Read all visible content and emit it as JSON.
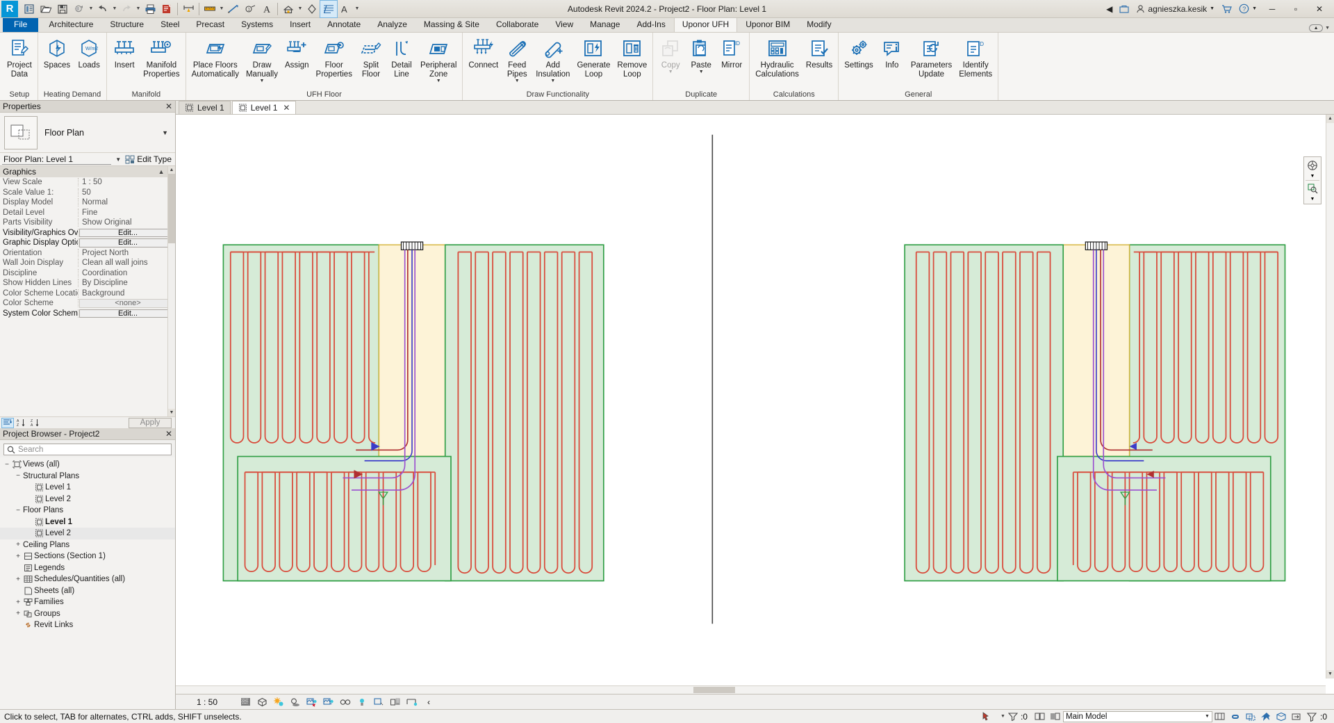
{
  "app": {
    "title": "Autodesk Revit 2024.2 - Project2 - Floor Plan: Level 1",
    "logo_letter": "R",
    "user": "agnieszka.kesik"
  },
  "quick_access": {
    "items": [
      {
        "name": "open-project-icon",
        "label": "Open"
      },
      {
        "name": "save-icon",
        "label": "Save"
      },
      {
        "name": "save-as-icon",
        "label": "Save As"
      },
      {
        "name": "undo-icon",
        "label": "Undo"
      },
      {
        "name": "redo-icon",
        "label": "Redo"
      },
      {
        "name": "print-icon",
        "label": "Print"
      },
      {
        "name": "measure-icon",
        "label": "Measure"
      },
      {
        "name": "aligned-dimension-icon",
        "label": "Aligned Dimension"
      },
      {
        "name": "tag-icon",
        "label": "Tag by Category"
      },
      {
        "name": "text-icon",
        "label": "Text"
      },
      {
        "name": "default-3d-view-icon",
        "label": "Default 3D View"
      },
      {
        "name": "section-icon",
        "label": "Section"
      },
      {
        "name": "thin-lines-icon",
        "label": "Thin Lines"
      },
      {
        "name": "close-hidden-windows-icon",
        "label": "Close Hidden Windows"
      }
    ]
  },
  "title_bar_right": {
    "search_placeholder": "",
    "account": "agnieszka.kesik",
    "icons": [
      "app-store-icon",
      "help-icon"
    ],
    "window_buttons": [
      "minimize",
      "maximize",
      "close"
    ]
  },
  "ribbon": {
    "tabs": [
      {
        "label": "File",
        "kind": "file"
      },
      {
        "label": "Architecture"
      },
      {
        "label": "Structure"
      },
      {
        "label": "Steel"
      },
      {
        "label": "Precast"
      },
      {
        "label": "Systems"
      },
      {
        "label": "Insert"
      },
      {
        "label": "Annotate"
      },
      {
        "label": "Analyze"
      },
      {
        "label": "Massing & Site"
      },
      {
        "label": "Collaborate"
      },
      {
        "label": "View"
      },
      {
        "label": "Manage"
      },
      {
        "label": "Add-Ins"
      },
      {
        "label": "Uponor UFH",
        "active": true
      },
      {
        "label": "Uponor BIM"
      },
      {
        "label": "Modify"
      }
    ],
    "panels": [
      {
        "title": "Setup",
        "buttons": [
          {
            "label": "Project\nData",
            "icon": "project-data-icon",
            "name": "project-data-button"
          }
        ]
      },
      {
        "title": "Heating Demand",
        "buttons": [
          {
            "label": "Spaces",
            "icon": "spaces-icon",
            "name": "spaces-button"
          },
          {
            "label": "Loads",
            "icon": "loads-icon",
            "name": "loads-button"
          }
        ]
      },
      {
        "title": "Manifold",
        "buttons": [
          {
            "label": "Insert",
            "icon": "manifold-insert-icon",
            "name": "insert-manifold-button"
          },
          {
            "label": "Manifold\nProperties",
            "icon": "manifold-properties-icon",
            "name": "manifold-properties-button"
          }
        ]
      },
      {
        "title": "UFH Floor",
        "buttons": [
          {
            "label": "Place Floors\nAutomatically",
            "icon": "place-floors-icon",
            "name": "place-floors-automatically-button"
          },
          {
            "label": "Draw\nManually",
            "icon": "draw-manually-icon",
            "name": "draw-manually-button",
            "dropdown": true
          },
          {
            "label": "Assign",
            "icon": "assign-icon",
            "name": "assign-button"
          },
          {
            "label": "Floor\nProperties",
            "icon": "floor-properties-icon",
            "name": "floor-properties-button"
          },
          {
            "label": "Split\nFloor",
            "icon": "split-floor-icon",
            "name": "split-floor-button"
          },
          {
            "label": "Detail\nLine",
            "icon": "detail-line-icon",
            "name": "detail-line-button"
          },
          {
            "label": "Peripheral\nZone",
            "icon": "peripheral-zone-icon",
            "name": "peripheral-zone-button",
            "dropdown": true
          }
        ]
      },
      {
        "title": "Draw Functionality",
        "buttons": [
          {
            "label": "Connect",
            "icon": "connect-icon",
            "name": "connect-button"
          },
          {
            "label": "Feed\nPipes",
            "icon": "feed-pipes-icon",
            "name": "feed-pipes-button",
            "dropdown": true
          },
          {
            "label": "Add\nInsulation",
            "icon": "add-insulation-icon",
            "name": "add-insulation-button",
            "dropdown": true
          },
          {
            "label": "Generate\nLoop",
            "icon": "generate-loop-icon",
            "name": "generate-loop-button"
          },
          {
            "label": "Remove\nLoop",
            "icon": "remove-loop-icon",
            "name": "remove-loop-button"
          }
        ]
      },
      {
        "title": "Duplicate",
        "buttons": [
          {
            "label": "Copy",
            "icon": "copy-icon",
            "name": "copy-button",
            "dropdown": true,
            "disabled": true
          },
          {
            "label": "Paste",
            "icon": "paste-icon",
            "name": "paste-button",
            "dropdown": true
          },
          {
            "label": "Mirror",
            "icon": "mirror-icon",
            "name": "mirror-button"
          }
        ]
      },
      {
        "title": "Calculations",
        "buttons": [
          {
            "label": "Hydraulic\nCalculations",
            "icon": "hydraulic-calculations-icon",
            "name": "hydraulic-calculations-button"
          },
          {
            "label": "Results",
            "icon": "results-icon",
            "name": "results-button"
          }
        ]
      },
      {
        "title": "General",
        "buttons": [
          {
            "label": "Settings",
            "icon": "settings-icon",
            "name": "settings-button"
          },
          {
            "label": "Info",
            "icon": "info-icon",
            "name": "info-button"
          },
          {
            "label": "Parameters\nUpdate",
            "icon": "parameters-update-icon",
            "name": "parameters-update-button"
          },
          {
            "label": "Identify\nElements",
            "icon": "identify-elements-icon",
            "name": "identify-elements-button"
          }
        ]
      }
    ]
  },
  "properties": {
    "panel_title": "Properties",
    "type_name": "Floor Plan",
    "selector_value": "Floor Plan: Level 1",
    "edit_type_label": "Edit Type",
    "section_title": "Graphics",
    "rows": [
      {
        "key": "View Scale",
        "value": "1 : 50",
        "type": "text"
      },
      {
        "key": "Scale Value    1:",
        "value": "50",
        "type": "text"
      },
      {
        "key": "Display Model",
        "value": "Normal",
        "type": "text"
      },
      {
        "key": "Detail Level",
        "value": "Fine",
        "type": "text"
      },
      {
        "key": "Parts Visibility",
        "value": "Show Original",
        "type": "text"
      },
      {
        "key": "Visibility/Graphics Ove...",
        "value": "Edit...",
        "type": "button",
        "bold": true
      },
      {
        "key": "Graphic Display Options",
        "value": "Edit...",
        "type": "button",
        "bold": true
      },
      {
        "key": "Orientation",
        "value": "Project North",
        "type": "text"
      },
      {
        "key": "Wall Join Display",
        "value": "Clean all wall joins",
        "type": "text"
      },
      {
        "key": "Discipline",
        "value": "Coordination",
        "type": "text"
      },
      {
        "key": "Show Hidden Lines",
        "value": "By Discipline",
        "type": "text"
      },
      {
        "key": "Color Scheme Location",
        "value": "Background",
        "type": "text"
      },
      {
        "key": "Color Scheme",
        "value": "<none>",
        "type": "flat"
      },
      {
        "key": "System Color Schemes",
        "value": "Edit...",
        "type": "button",
        "bold": true
      }
    ],
    "apply_label": "Apply",
    "toolbar_icons": [
      "property-list-icon",
      "sort-az-icon",
      "sort-za-icon"
    ]
  },
  "project_browser": {
    "panel_title": "Project Browser - Project2",
    "search_placeholder": "Search",
    "tree": [
      {
        "label": "Views (all)",
        "level": 0,
        "expander": "−",
        "icon": "views-icon"
      },
      {
        "label": "Structural Plans",
        "level": 1,
        "expander": "−",
        "icon": ""
      },
      {
        "label": "Level 1",
        "level": 2,
        "expander": "",
        "icon": "plan-icon"
      },
      {
        "label": "Level 2",
        "level": 2,
        "expander": "",
        "icon": "plan-icon"
      },
      {
        "label": "Floor Plans",
        "level": 1,
        "expander": "−",
        "icon": ""
      },
      {
        "label": "Level 1",
        "level": 2,
        "expander": "",
        "icon": "plan-icon",
        "bold": true
      },
      {
        "label": "Level 2",
        "level": 2,
        "expander": "",
        "icon": "plan-icon",
        "selected": true
      },
      {
        "label": "Ceiling Plans",
        "level": 1,
        "expander": "+",
        "icon": ""
      },
      {
        "label": "Sections (Section 1)",
        "level": 1,
        "expander": "+",
        "icon": "section-browser-icon"
      },
      {
        "label": "Legends",
        "level": 1,
        "expander": "",
        "icon": "legend-icon"
      },
      {
        "label": "Schedules/Quantities (all)",
        "level": 1,
        "expander": "+",
        "icon": "schedule-icon"
      },
      {
        "label": "Sheets (all)",
        "level": 1,
        "expander": "",
        "icon": "sheet-icon"
      },
      {
        "label": "Families",
        "level": 1,
        "expander": "+",
        "icon": "families-icon"
      },
      {
        "label": "Groups",
        "level": 1,
        "expander": "+",
        "icon": "groups-icon"
      },
      {
        "label": "Revit Links",
        "level": 1,
        "expander": "",
        "icon": "revit-links-icon"
      }
    ]
  },
  "view_tabs": [
    {
      "label": "Level 1",
      "active": false,
      "icon": "plan-icon"
    },
    {
      "label": "Level 1",
      "active": true,
      "icon": "plan-icon",
      "closable": true
    }
  ],
  "view_control_bar": {
    "scale": "1 : 50",
    "icons": [
      "detail-level-icon",
      "visual-style-icon",
      "sun-path-icon",
      "shadows-icon",
      "render-dialog-icon",
      "crop-view-icon",
      "show-crop-region-icon",
      "temporary-hide-isolate-icon",
      "reveal-hidden-elements-icon",
      "temporary-view-properties-icon",
      "analytical-model-icon",
      "constraints-icon",
      "expand-icon"
    ]
  },
  "status_bar": {
    "message": "Click to select, TAB for alternates, CTRL adds, SHIFT unselects.",
    "filter_count": ":0",
    "model_selector": "Main Model",
    "selection_count": ":0",
    "right_icons": [
      "worksets-icon",
      "design-options-icon",
      "ready-icon",
      "exclude-options-icon",
      "filter-options-icon",
      "select-links-icon",
      "select-pinned-icon"
    ]
  },
  "drawing": {
    "colors": {
      "floor_green": "#d6ebd7",
      "floor_green_border": "#2f9e44",
      "floor_cream": "#fdf3d7",
      "floor_cream_border": "#d4b33a",
      "loop_red": "#d94a3a",
      "supply_pipe": "#b03030",
      "return_pipe": "#3b3bc9",
      "manifold_purple": "#9b4fd0",
      "section_line": "#4a4a4a"
    },
    "rooms": [
      {
        "name": "room-a-left",
        "fill": "green"
      },
      {
        "name": "room-a-center",
        "fill": "cream"
      },
      {
        "name": "room-a-right",
        "fill": "green"
      },
      {
        "name": "room-a-bottom",
        "fill": "green"
      },
      {
        "name": "room-b-left",
        "fill": "green"
      },
      {
        "name": "room-b-center",
        "fill": "cream"
      },
      {
        "name": "room-b-right",
        "fill": "green"
      },
      {
        "name": "room-b-bottom",
        "fill": "green"
      }
    ]
  }
}
